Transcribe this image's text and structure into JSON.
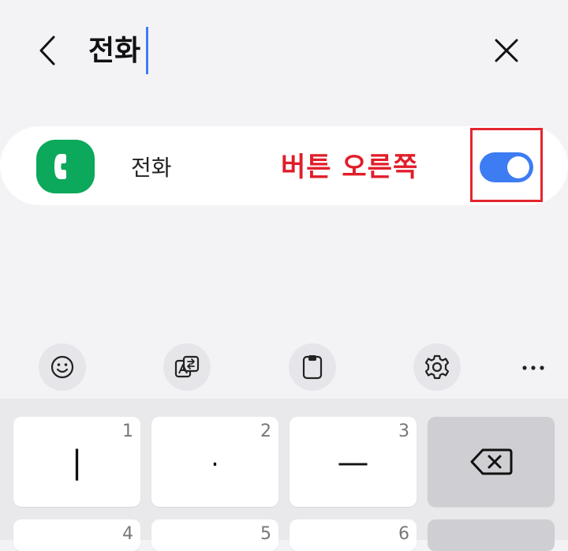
{
  "search": {
    "query": "전화"
  },
  "result": {
    "app_label": "전화",
    "annotation": "버튼 오른쪽",
    "toggle_state": "on"
  },
  "colors": {
    "accent_blue": "#3d7cf2",
    "app_green": "#0ca85b",
    "annotation_red": "#e11d2a"
  },
  "toolbar": {
    "icons": [
      "emoji-icon",
      "translate-icon",
      "clipboard-icon",
      "settings-icon",
      "more-icon"
    ]
  },
  "keyboard": {
    "row1": [
      {
        "symbol": "|",
        "number": "1"
      },
      {
        "symbol": "·",
        "number": "2"
      },
      {
        "symbol": "—",
        "number": "3"
      }
    ],
    "row2_numbers": [
      "4",
      "5",
      "6"
    ]
  }
}
